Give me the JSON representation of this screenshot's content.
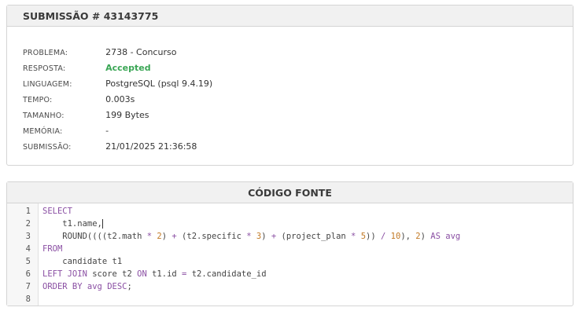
{
  "submission": {
    "title": "SUBMISSÃO # 43143775",
    "fields": [
      {
        "label": "PROBLEMA:",
        "value": "2738 - Concurso"
      },
      {
        "label": "RESPOSTA:",
        "value": "Accepted"
      },
      {
        "label": "LINGUAGEM:",
        "value": "PostgreSQL (psql 9.4.19)"
      },
      {
        "label": "TEMPO:",
        "value": "0.003s"
      },
      {
        "label": "TAMANHO:",
        "value": "199 Bytes"
      },
      {
        "label": "MEMÓRIA:",
        "value": "-"
      },
      {
        "label": "SUBMISSÃO:",
        "value": "21/01/2025 21:36:58"
      }
    ],
    "accepted_color": "#3aa655"
  },
  "code": {
    "title": "CÓDIGO FONTE",
    "keyword_color": "#8a4fa3",
    "number_color": "#c27a26",
    "lines": [
      {
        "n": "1",
        "tokens": [
          {
            "t": "kw",
            "v": "SELECT"
          }
        ]
      },
      {
        "n": "2",
        "tokens": [
          {
            "t": "txt",
            "v": "    t1.name,"
          },
          {
            "t": "cursor",
            "v": ""
          }
        ]
      },
      {
        "n": "3",
        "tokens": [
          {
            "t": "txt",
            "v": "    ROUND((((t2.math "
          },
          {
            "t": "kw",
            "v": "*"
          },
          {
            "t": "txt",
            "v": " "
          },
          {
            "t": "num",
            "v": "2"
          },
          {
            "t": "txt",
            "v": ") "
          },
          {
            "t": "kw",
            "v": "+"
          },
          {
            "t": "txt",
            "v": " (t2.specific "
          },
          {
            "t": "kw",
            "v": "*"
          },
          {
            "t": "txt",
            "v": " "
          },
          {
            "t": "num",
            "v": "3"
          },
          {
            "t": "txt",
            "v": ") "
          },
          {
            "t": "kw",
            "v": "+"
          },
          {
            "t": "txt",
            "v": " (project_plan "
          },
          {
            "t": "kw",
            "v": "*"
          },
          {
            "t": "txt",
            "v": " "
          },
          {
            "t": "num",
            "v": "5"
          },
          {
            "t": "txt",
            "v": ")) "
          },
          {
            "t": "kw",
            "v": "/"
          },
          {
            "t": "txt",
            "v": " "
          },
          {
            "t": "num",
            "v": "10"
          },
          {
            "t": "txt",
            "v": "), "
          },
          {
            "t": "num",
            "v": "2"
          },
          {
            "t": "txt",
            "v": ") "
          },
          {
            "t": "kw",
            "v": "AS"
          },
          {
            "t": "txt",
            "v": " "
          },
          {
            "t": "kw",
            "v": "avg"
          }
        ]
      },
      {
        "n": "4",
        "tokens": [
          {
            "t": "kw",
            "v": "FROM"
          }
        ]
      },
      {
        "n": "5",
        "tokens": [
          {
            "t": "txt",
            "v": "    candidate t1"
          }
        ]
      },
      {
        "n": "6",
        "tokens": [
          {
            "t": "kw",
            "v": "LEFT JOIN"
          },
          {
            "t": "txt",
            "v": " score t2 "
          },
          {
            "t": "kw",
            "v": "ON"
          },
          {
            "t": "txt",
            "v": " t1.id "
          },
          {
            "t": "kw",
            "v": "="
          },
          {
            "t": "txt",
            "v": " t2.candidate_id"
          }
        ]
      },
      {
        "n": "7",
        "tokens": [
          {
            "t": "kw",
            "v": "ORDER BY"
          },
          {
            "t": "txt",
            "v": " "
          },
          {
            "t": "kw",
            "v": "avg"
          },
          {
            "t": "txt",
            "v": " "
          },
          {
            "t": "kw",
            "v": "DESC"
          },
          {
            "t": "txt",
            "v": ";"
          }
        ]
      },
      {
        "n": "8",
        "tokens": []
      }
    ]
  }
}
